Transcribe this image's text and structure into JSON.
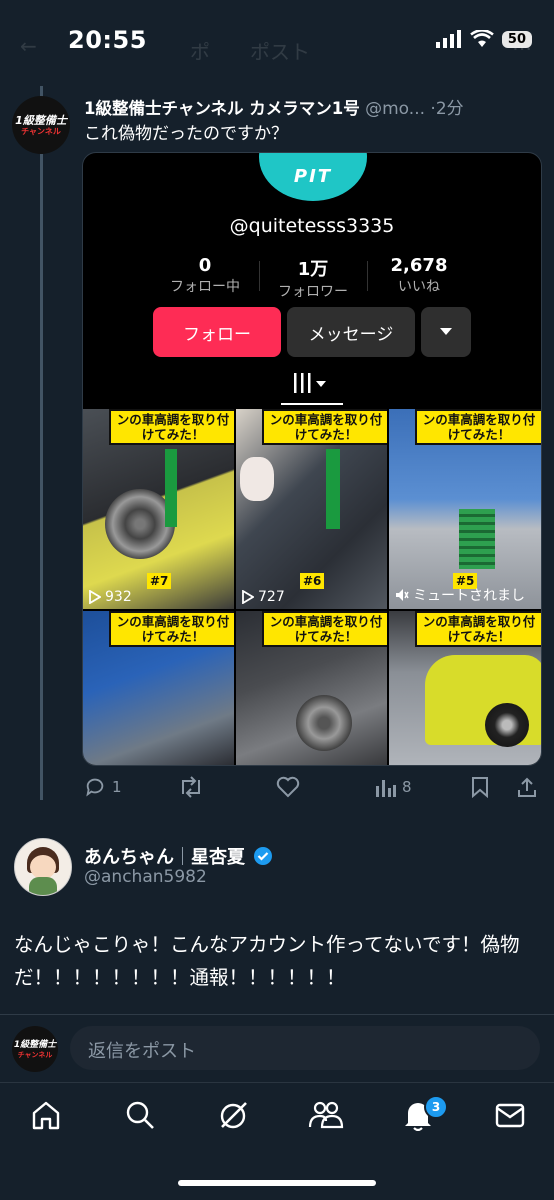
{
  "status": {
    "time": "20:55",
    "battery": "50"
  },
  "ghost_header": {
    "left": "ポ",
    "center": "ポスト"
  },
  "parent_tweet": {
    "avatar_line1": "1級整備士",
    "avatar_line2": "チャンネル",
    "name": "1級整備士チャンネル カメラマン1号",
    "handle": "@mo...",
    "time": "2分",
    "text": "これ偽物だったのですか？",
    "replies": "1",
    "views": "8"
  },
  "tiktok_profile": {
    "logo_text": "PIT",
    "username": "@quitetesss3335",
    "stats": [
      {
        "value": "0",
        "label": "フォロー中"
      },
      {
        "value": "1万",
        "label": "フォロワー"
      },
      {
        "value": "2,678",
        "label": "いいね"
      }
    ],
    "follow_button": "フォロー",
    "message_button": "メッセージ",
    "videos": [
      {
        "banner": "ンの車高調を取り付けてみた！",
        "views": "932",
        "episode": "#7"
      },
      {
        "banner": "ンの車高調を取り付けてみた！",
        "views": "727",
        "episode": "#6"
      },
      {
        "banner": "ンの車高調を取り付けてみた！",
        "views": "ミュートされまし",
        "episode": "#5"
      },
      {
        "banner": "ンの車高調を取り付けてみた！",
        "views": "",
        "episode": ""
      },
      {
        "banner": "ンの車高調を取り付けてみた！",
        "views": "",
        "episode": ""
      },
      {
        "banner": "ンの車高調を取り付けてみた！",
        "views": "",
        "episode": ""
      }
    ]
  },
  "reply_tweet": {
    "name": "あんちゃん",
    "name_suffix": "星杏夏",
    "handle": "@anchan5982",
    "text": "なんじゃこりゃ！こんなアカウント作ってないです！偽物だ！！！！！！！！通報！！！！！！"
  },
  "composer": {
    "placeholder": "返信をポスト"
  },
  "bottom_nav": {
    "notifications_badge": "3"
  },
  "colors": {
    "background": "#15202b",
    "tiktok_red": "#fe2c55",
    "verified": "#1d9bf0"
  }
}
